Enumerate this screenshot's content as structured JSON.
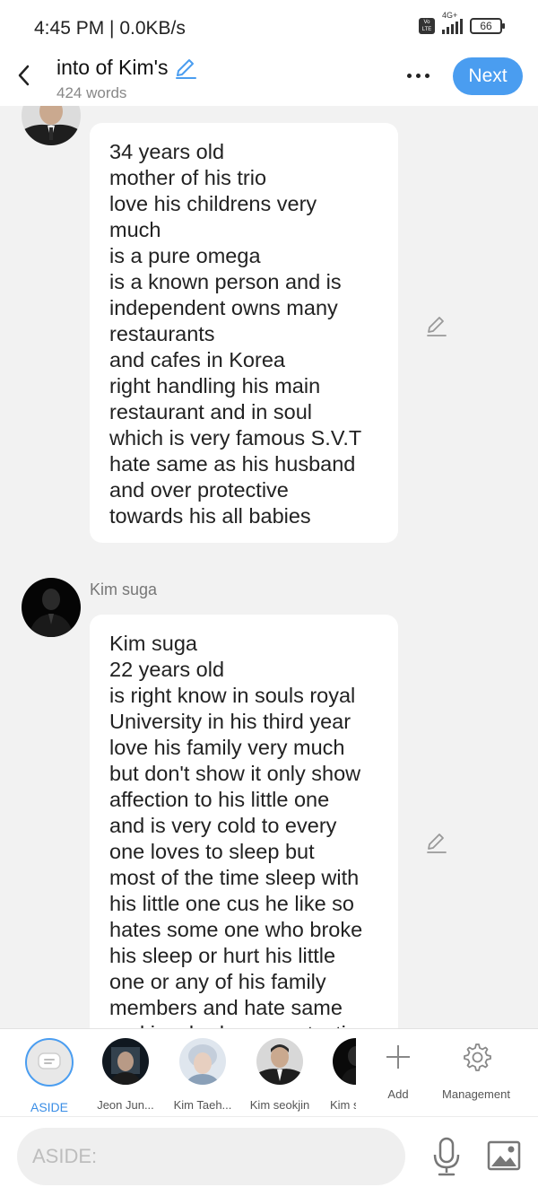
{
  "status_bar": {
    "time": "4:45 PM | 0.0KB/s",
    "volte": "Vo LTE",
    "network": "4G+",
    "battery": "66"
  },
  "header": {
    "title": "into of Kim's",
    "word_count": "424 words",
    "next_label": "Next"
  },
  "messages": [
    {
      "speaker": "",
      "text": "34 years old\nmother of his trio\nlove his childrens very\nmuch\nis a pure omega\nis a known person and is\nindependent owns many\nrestaurants\nand cafes in Korea\nright handling his main\nrestaurant and in soul\nwhich is very famous S.V.T\nhate same as his husband\nand over protective\ntowards his all babies"
    },
    {
      "speaker": "Kim suga",
      "text": "Kim suga\n22 years old\nis right know in souls royal\nUniversity in his third year\nlove his family very much\nbut don't show it only show\naffection to his little one\nand is very cold to every\none  loves to sleep but\nmost of the time sleep with\nhis little one cus he like so\nhates some one who broke\nhis sleep or hurt his little\none or any of his family\nmembers and hate same\nand is a bad over protective"
    }
  ],
  "characters": [
    {
      "label": "ASIDE",
      "selected": true
    },
    {
      "label": "Jeon Jun..."
    },
    {
      "label": "Kim Taeh..."
    },
    {
      "label": "Kim seokjin"
    },
    {
      "label": "Kim s"
    }
  ],
  "toolbar": {
    "add_label": "Add",
    "management_label": "Management"
  },
  "input": {
    "placeholder": "ASIDE:"
  },
  "colors": {
    "accent": "#4a9df0",
    "background": "#f2f2f2",
    "bubble": "#ffffff"
  }
}
